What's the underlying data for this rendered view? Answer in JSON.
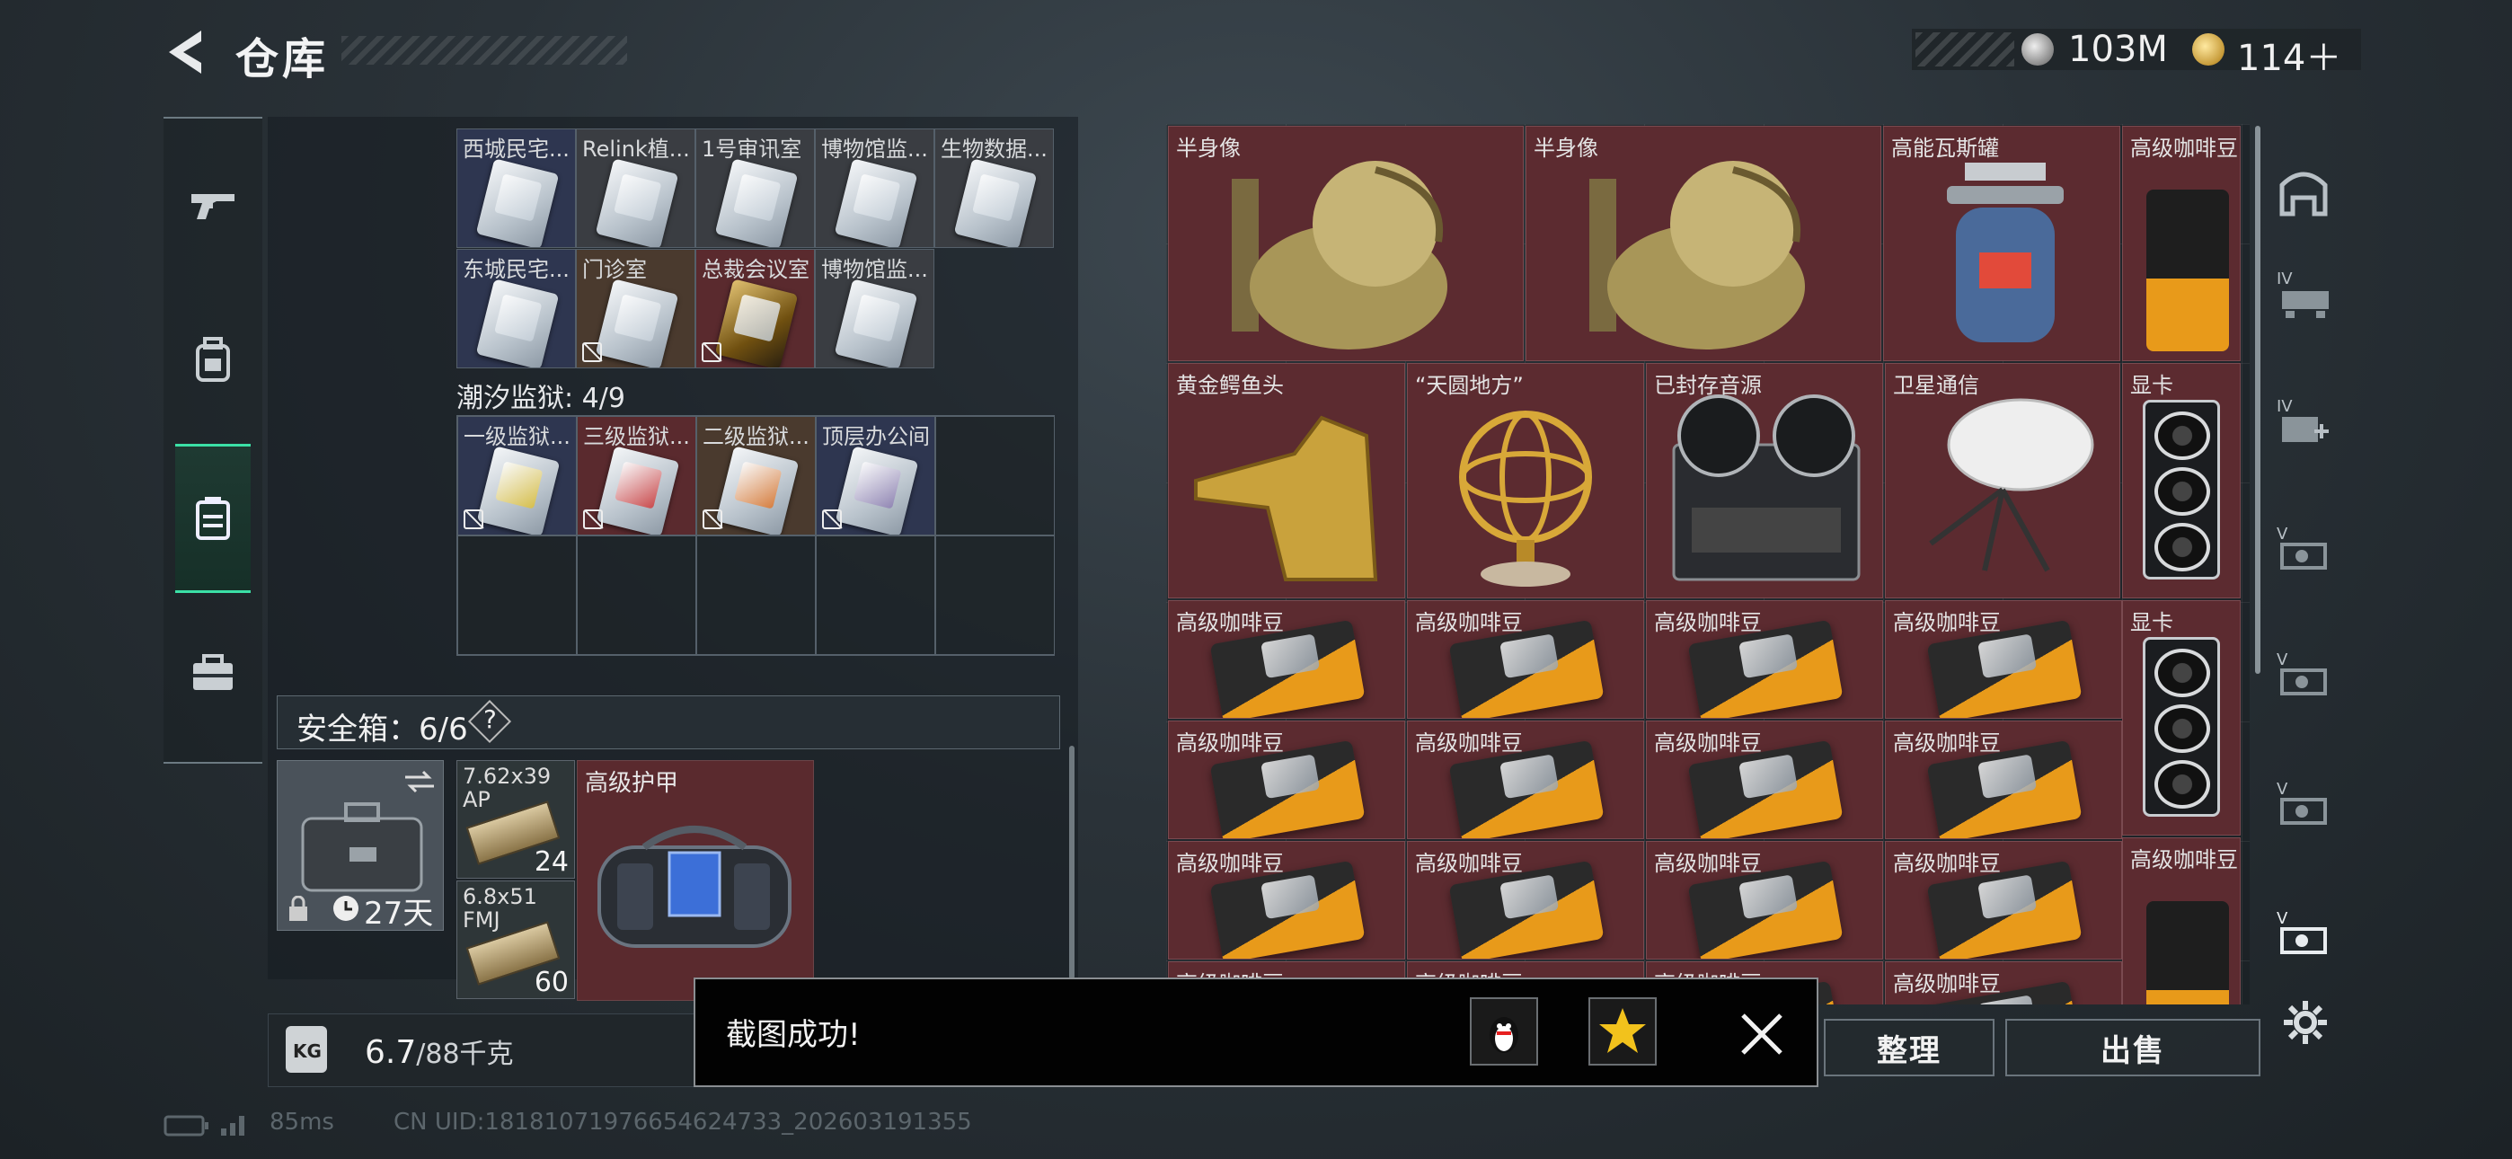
{
  "header": {
    "title": "仓库",
    "currency_1": "103M",
    "currency_2": "114＋"
  },
  "left_panel": {
    "key_row_1": [
      {
        "label": "西城民宅...",
        "bg": "bg-blue"
      },
      {
        "label": "Relink植...",
        "bg": "bg-grey"
      },
      {
        "label": "1号审讯室",
        "bg": "bg-grey"
      },
      {
        "label": "博物馆监...",
        "bg": "bg-grey"
      },
      {
        "label": "生物数据...",
        "bg": "bg-grey"
      }
    ],
    "key_row_2": [
      {
        "label": "东城民宅...",
        "bg": "bg-blue"
      },
      {
        "label": "门诊室",
        "bg": "bg-brown"
      },
      {
        "label": "总裁会议室",
        "bg": "bg-red"
      },
      {
        "label": "博物馆监...",
        "bg": "bg-grey"
      }
    ],
    "prison_title": "潮汐监狱: 4/9",
    "prison_row": [
      {
        "label": "一级监狱...",
        "bg": "bg-blue"
      },
      {
        "label": "三级监狱...",
        "bg": "bg-red"
      },
      {
        "label": "二级监狱...",
        "bg": "bg-brown"
      },
      {
        "label": "顶层办公间",
        "bg": "bg-blue"
      }
    ],
    "safe_title": "安全箱：6/6",
    "safe_help": "?",
    "safe_time": "27天",
    "ammo": [
      {
        "line1": "7.62x39",
        "line2": "AP",
        "count": "24"
      },
      {
        "line1": "6.8x51",
        "line2": "FMJ",
        "count": "60"
      }
    ],
    "armor_label": "高级护甲",
    "weight_value": "6.7",
    "weight_max": "/88千克",
    "weight_icon_text": "KG"
  },
  "right_grid": {
    "items": {
      "bust1": "半身像",
      "bust2": "半身像",
      "gas": "高能瓦斯罐",
      "coffee_tall_1": "高级咖啡豆",
      "croc": "黄金鳄鱼头",
      "globe": "“天圆地方”",
      "tape": "已封存音源",
      "sat": "卫星通信",
      "gpu1": "显卡",
      "gpu2": "显卡",
      "coffee_tall_2": "高级咖啡豆",
      "coffee": "高级咖啡豆"
    }
  },
  "buttons": {
    "sort": "整理",
    "sell": "出售"
  },
  "toast": {
    "message": "截图成功!"
  },
  "status": {
    "ping": "85ms",
    "uid": "CN UID:181810719766546247​33_202603191355"
  }
}
